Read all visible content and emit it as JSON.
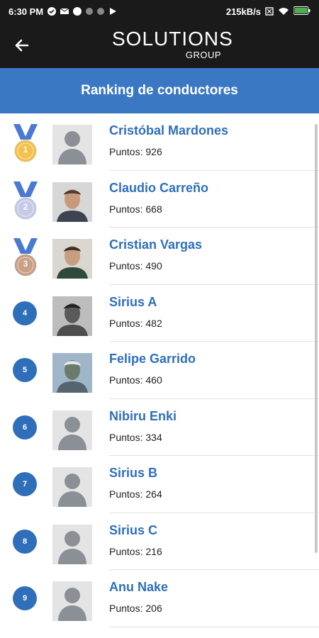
{
  "status_bar": {
    "time": "6:30 PM",
    "speed": "215kB/s"
  },
  "app_bar": {
    "logo_main": "SOLUTIONS",
    "logo_sub": "GROUP"
  },
  "page": {
    "title": "Ranking de conductores"
  },
  "ranking": [
    {
      "rank": "1",
      "name": "Cristóbal Mardones",
      "points": "Puntos: 926",
      "medal": "gold",
      "avatar": "placeholder"
    },
    {
      "rank": "2",
      "name": "Claudio Carreño",
      "points": "Puntos: 668",
      "medal": "silver",
      "avatar": "photo"
    },
    {
      "rank": "3",
      "name": "Cristian Vargas",
      "points": "Puntos: 490",
      "medal": "bronze",
      "avatar": "photo"
    },
    {
      "rank": "4",
      "name": "Sirius A",
      "points": "Puntos: 482",
      "avatar": "photo"
    },
    {
      "rank": "5",
      "name": "Felipe Garrido",
      "points": "Puntos: 460",
      "avatar": "photo"
    },
    {
      "rank": "6",
      "name": "Nibiru Enki",
      "points": "Puntos: 334",
      "avatar": "placeholder"
    },
    {
      "rank": "7",
      "name": "Sirius B",
      "points": "Puntos: 264",
      "avatar": "placeholder"
    },
    {
      "rank": "8",
      "name": "Sirius C",
      "points": "Puntos: 216",
      "avatar": "placeholder"
    },
    {
      "rank": "9",
      "name": "Anu Nake",
      "points": "Puntos: 206",
      "avatar": "placeholder"
    }
  ],
  "colors": {
    "header": "#1a1a1a",
    "title_bar": "#3b78c4",
    "accent": "#2f6fba",
    "gold": "#f2c14e",
    "silver": "#c5cbe6",
    "bronze": "#c99f86"
  }
}
